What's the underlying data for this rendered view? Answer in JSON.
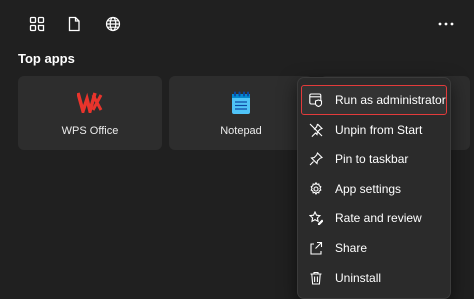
{
  "section_title": "Top apps",
  "tiles": [
    {
      "label": "WPS Office",
      "icon": "wps-logo-icon"
    },
    {
      "label": "Notepad",
      "icon": "notepad-icon"
    }
  ],
  "context_menu": [
    {
      "label": "Run as administrator",
      "icon": "shield-window-icon"
    },
    {
      "label": "Unpin from Start",
      "icon": "unpin-icon"
    },
    {
      "label": "Pin to taskbar",
      "icon": "pin-icon"
    },
    {
      "label": "App settings",
      "icon": "gear-icon"
    },
    {
      "label": "Rate and review",
      "icon": "star-edit-icon"
    },
    {
      "label": "Share",
      "icon": "share-icon"
    },
    {
      "label": "Uninstall",
      "icon": "trash-icon"
    }
  ],
  "colors": {
    "background": "#202020",
    "tile": "#2d2d2d",
    "menu": "#2b2b2b",
    "highlight_outline": "#e33b3b",
    "wps_red": "#e8342c"
  }
}
